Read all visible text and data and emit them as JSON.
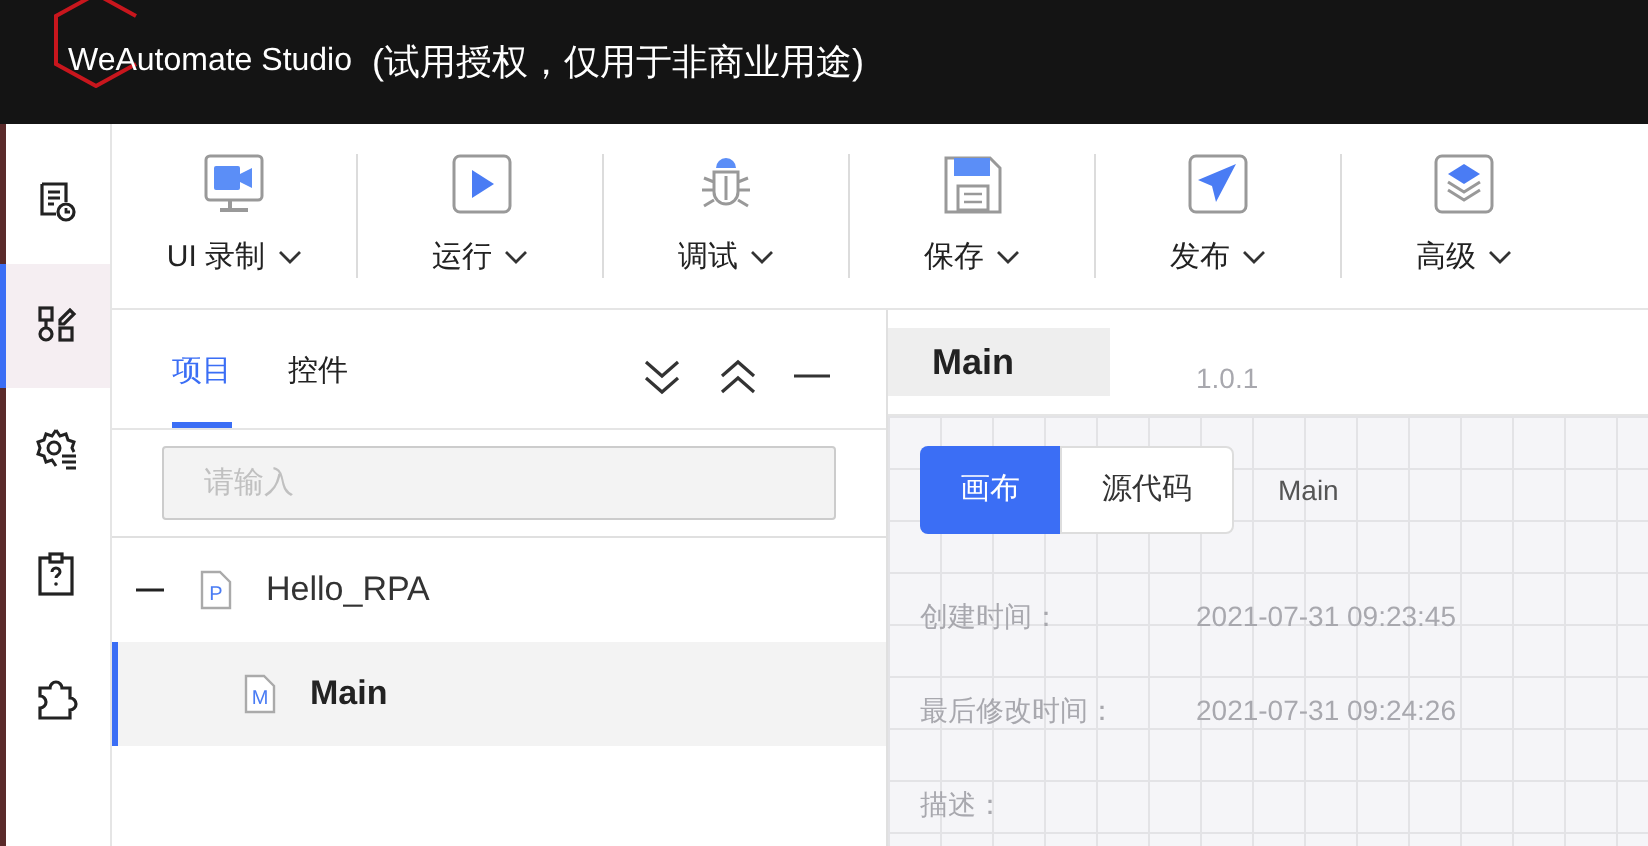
{
  "title_bar": {
    "logo_text": "WeAutomate Studio",
    "subtitle": "(试用授权，仅用于非商业用途)"
  },
  "rail": [
    {
      "kind": "doc-clock",
      "selected": false
    },
    {
      "kind": "flow",
      "selected": true
    },
    {
      "kind": "gear-list",
      "selected": false
    },
    {
      "kind": "clipboard-question",
      "selected": false
    },
    {
      "kind": "puzzle",
      "selected": false
    }
  ],
  "toolbar": [
    {
      "kind": "record",
      "label": "UI 录制"
    },
    {
      "kind": "run",
      "label": "运行"
    },
    {
      "kind": "debug",
      "label": "调试"
    },
    {
      "kind": "save",
      "label": "保存"
    },
    {
      "kind": "publish",
      "label": "发布"
    },
    {
      "kind": "advanced",
      "label": "高级"
    }
  ],
  "project_panel": {
    "tabs": [
      {
        "label": "项目",
        "selected": true
      },
      {
        "label": "控件",
        "selected": false
      }
    ],
    "search": {
      "placeholder": "请输入"
    },
    "tree": [
      {
        "label": "Hello_RPA",
        "icon_letter": "P",
        "expanded": true,
        "selected": false,
        "children": [
          {
            "label": "Main",
            "icon_letter": "M",
            "selected": true
          }
        ]
      }
    ]
  },
  "editor": {
    "tab": {
      "label": "Main"
    },
    "views": [
      {
        "label": "画布",
        "selected": true
      },
      {
        "label": "源代码",
        "selected": false
      }
    ],
    "breadcrumb": "Main",
    "faded_info": [
      {
        "value": "1.0.1"
      },
      {
        "label": "创建时间：",
        "value": "2021-07-31 09:23:45"
      },
      {
        "label": "最后修改时间：",
        "value": "2021-07-31 09:24:26"
      },
      {
        "label": "描述："
      }
    ]
  }
}
